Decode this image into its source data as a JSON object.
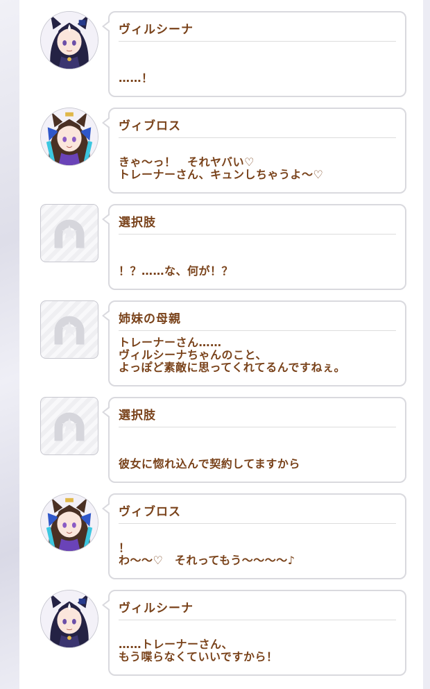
{
  "dialogue": [
    {
      "type": "character",
      "avatar_icon": "vilsena-portrait",
      "speaker": "ヴィルシーナ",
      "text": "……！"
    },
    {
      "type": "character",
      "avatar_icon": "vivlos-portrait",
      "speaker": "ヴィブロス",
      "text": "きゃ～っ！　それヤバい♡\nトレーナーさん、キュンしちゃうよ～♡"
    },
    {
      "type": "placeholder",
      "avatar_icon": "horseshoe-placeholder-icon",
      "speaker": "選択肢",
      "text": "！？……な、何が！？"
    },
    {
      "type": "placeholder",
      "avatar_icon": "horseshoe-placeholder-icon",
      "speaker": "姉妹の母親",
      "text": "トレーナーさん……\nヴィルシーナちゃんのこと、\nよっぽど素敵に思ってくれてるんですねぇ。"
    },
    {
      "type": "placeholder",
      "avatar_icon": "horseshoe-placeholder-icon",
      "speaker": "選択肢",
      "text": "彼女に惚れ込んで契約してますから"
    },
    {
      "type": "character",
      "avatar_icon": "vivlos-portrait",
      "speaker": "ヴィブロス",
      "text": "！\nわ～～♡　それってもう～～～～♪"
    },
    {
      "type": "character",
      "avatar_icon": "vilsena-portrait",
      "speaker": "ヴィルシーナ",
      "text": "……トレーナーさん、\nもう喋らなくていいですから！"
    }
  ],
  "colors": {
    "text": "#79421a",
    "bubble_border": "#d9d9de",
    "vivlos_ribbon": "#2f57c9",
    "vilsena_hair": "#242244"
  }
}
